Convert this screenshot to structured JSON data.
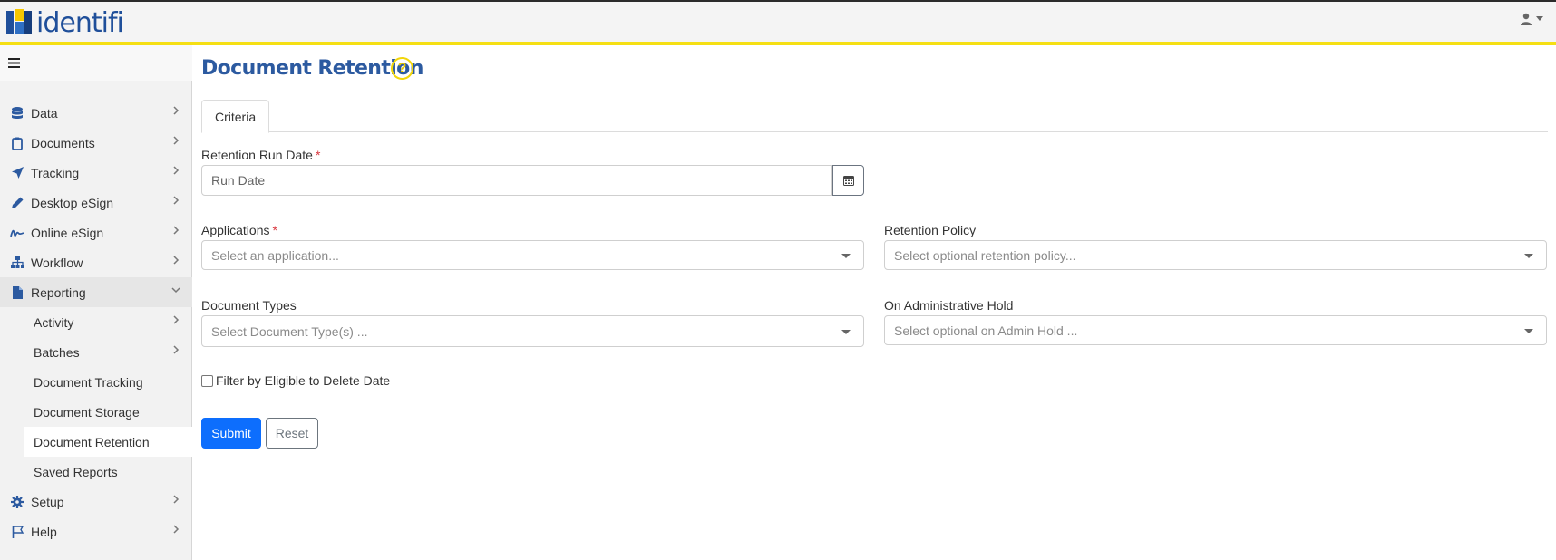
{
  "app": {
    "logo_text": "identifi",
    "colors": {
      "brand_blue": "#1f4f9a",
      "accent_yellow": "#f5df13",
      "primary": "#0d6efd"
    }
  },
  "header": {
    "user_icon": "user-icon"
  },
  "sidebar": {
    "items": [
      {
        "label": "Data",
        "icon": "database-icon"
      },
      {
        "label": "Documents",
        "icon": "clipboard-icon"
      },
      {
        "label": "Tracking",
        "icon": "location-arrow-icon"
      },
      {
        "label": "Desktop eSign",
        "icon": "pencil-icon"
      },
      {
        "label": "Online eSign",
        "icon": "signature-icon"
      },
      {
        "label": "Workflow",
        "icon": "sitemap-icon"
      },
      {
        "label": "Reporting",
        "icon": "file-icon"
      }
    ],
    "reporting_sub": [
      {
        "label": "Activity"
      },
      {
        "label": "Batches"
      },
      {
        "label": "Document Tracking"
      },
      {
        "label": "Document Storage"
      },
      {
        "label": "Document Retention"
      },
      {
        "label": "Saved Reports"
      }
    ],
    "bottom_items": [
      {
        "label": "Setup",
        "icon": "gear-icon"
      },
      {
        "label": "Help",
        "icon": "flag-icon"
      }
    ]
  },
  "main": {
    "title": "Document Retention",
    "tabs": [
      {
        "label": "Criteria"
      }
    ],
    "form": {
      "run_date_label": "Retention Run Date",
      "run_date_placeholder": "Run Date",
      "applications_label": "Applications",
      "applications_placeholder": "Select an application...",
      "retention_policy_label": "Retention Policy",
      "retention_policy_placeholder": "Select optional retention policy...",
      "document_types_label": "Document Types",
      "document_types_placeholder": "Select Document Type(s) ...",
      "admin_hold_label": "On Administrative Hold",
      "admin_hold_placeholder": "Select optional on Admin Hold ...",
      "filter_checkbox_label": "Filter by Eligible to Delete Date",
      "required_mark": "*"
    },
    "buttons": {
      "submit": "Submit",
      "reset": "Reset"
    }
  }
}
